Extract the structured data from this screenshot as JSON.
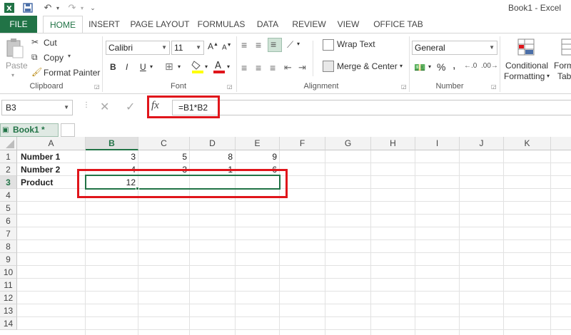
{
  "window": {
    "title": "Book1 - Excel"
  },
  "tabs": [
    "FILE",
    "HOME",
    "INSERT",
    "PAGE LAYOUT",
    "FORMULAS",
    "DATA",
    "REVIEW",
    "VIEW",
    "OFFICE TAB"
  ],
  "ribbon": {
    "clipboard": {
      "paste": "Paste",
      "cut": "Cut",
      "copy": "Copy",
      "format_painter": "Format Painter",
      "label": "Clipboard"
    },
    "font": {
      "name": "Calibri",
      "size": "11",
      "bold": "B",
      "italic": "I",
      "underline": "U",
      "label": "Font"
    },
    "alignment": {
      "wrap_text": "Wrap Text",
      "merge_center": "Merge & Center",
      "label": "Alignment"
    },
    "number": {
      "format": "General",
      "label": "Number"
    },
    "styles": {
      "conditional_1": "Conditional",
      "conditional_2": "Formatting",
      "format_table_1": "Form",
      "format_table_2": "Tab"
    }
  },
  "formula_bar": {
    "name_box": "B3",
    "fx": "fx",
    "formula": "=B1*B2"
  },
  "workbook_tab": {
    "name": "Book1 *"
  },
  "sheet": {
    "columns": [
      "A",
      "B",
      "C",
      "D",
      "E",
      "F",
      "G",
      "H",
      "I",
      "J",
      "K"
    ],
    "selected_column": "B",
    "rows": [
      "1",
      "2",
      "3",
      "4",
      "5",
      "6",
      "7",
      "8",
      "9",
      "10",
      "11",
      "12",
      "13",
      "14"
    ],
    "selected_row": "3",
    "cells": {
      "A1": "Number 1",
      "B1": "3",
      "C1": "5",
      "D1": "8",
      "E1": "9",
      "A2": "Number 2",
      "B2": "4",
      "C2": "3",
      "D2": "1",
      "E2": "6",
      "A3": "Product",
      "B3": "12"
    },
    "active_cell": "B3"
  },
  "colors": {
    "excel_green": "#217346",
    "highlight_red": "#e0151b"
  }
}
